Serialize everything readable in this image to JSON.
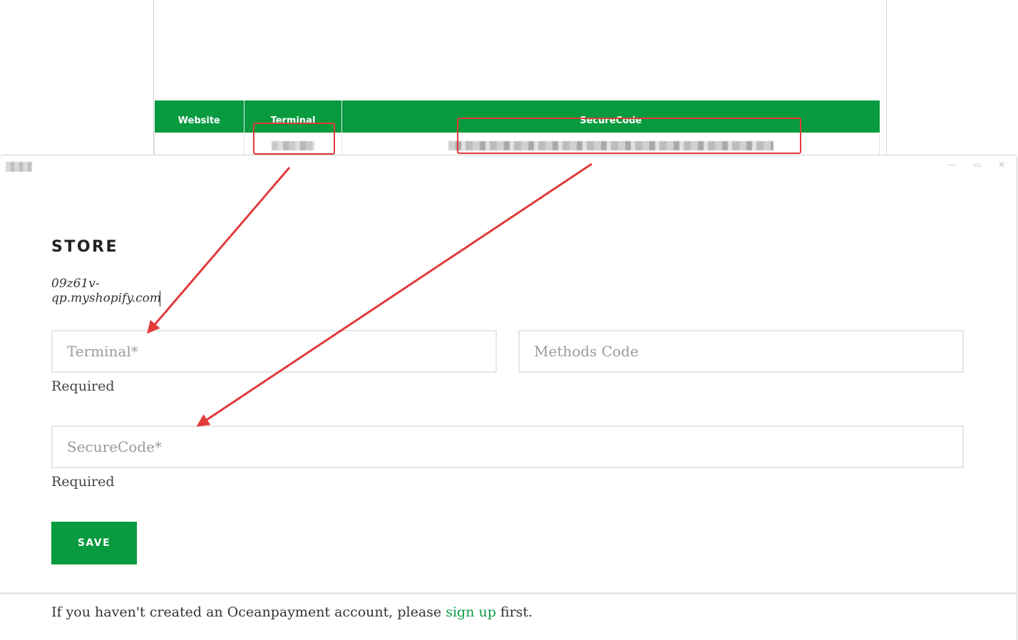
{
  "credentials_table": {
    "headers": [
      "Website",
      "Terminal",
      "SecureCode"
    ]
  },
  "modal": {
    "section_title": "STORE",
    "store_domain": "09z61v-qp.myshopify.com",
    "fields": {
      "terminal_placeholder": "Terminal*",
      "methods_code_placeholder": "Methods Code",
      "securecode_placeholder": "SecureCode*",
      "terminal_hint": "Required",
      "securecode_hint": "Required"
    },
    "save_label": "SAVE",
    "footer": {
      "prefix": "If you haven't created an Oceanpayment account, please ",
      "link_text": "sign up",
      "suffix": " first."
    },
    "window_controls": {
      "minimize_icon": "minimize-icon",
      "maximize_icon": "maximize-icon",
      "close_icon": "close-icon"
    }
  },
  "annotations": {
    "highlight_color": "#e23b3b"
  },
  "colors": {
    "brand_green": "#079a3e",
    "link_green": "#0a9e48"
  }
}
